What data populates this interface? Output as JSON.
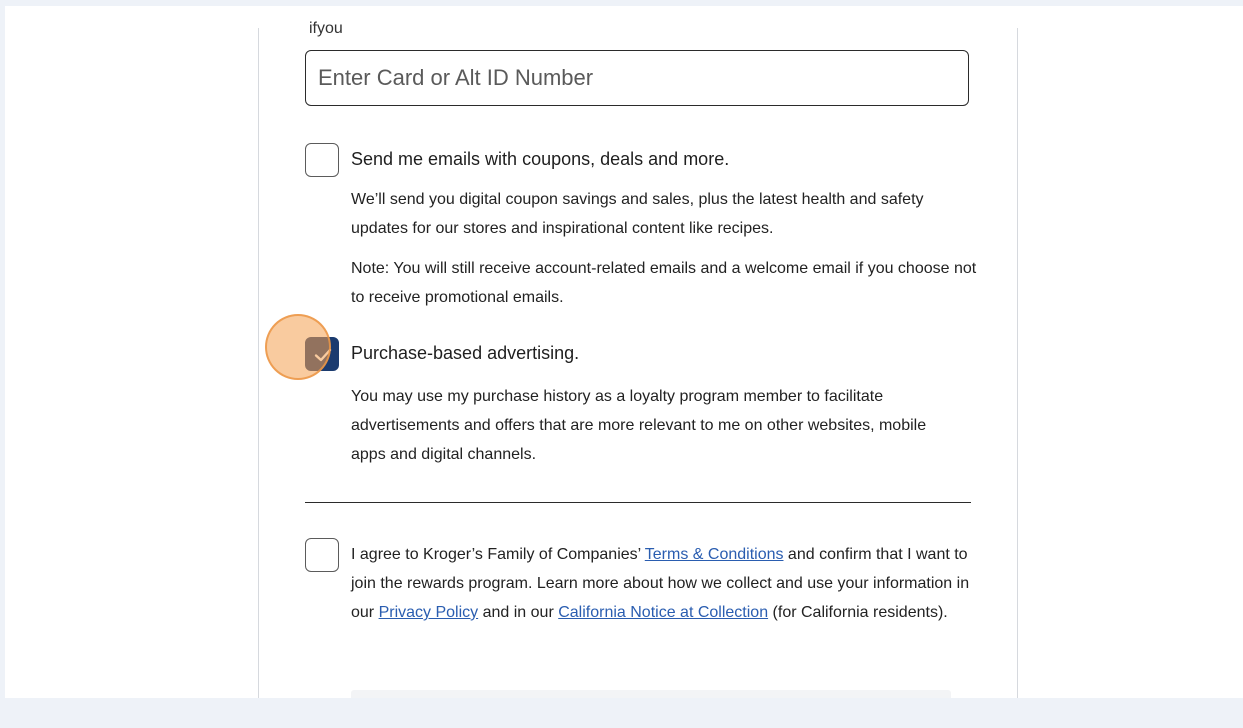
{
  "form": {
    "cutoff_label": "ifyou",
    "card_input": {
      "placeholder": "Enter Card or Alt ID Number",
      "value": ""
    },
    "email_opt_in": {
      "label": "Send me emails with coupons, deals and more.",
      "description": "We’ll send you digital coupon savings and sales, plus the latest health and safety updates for our stores and inspirational content like recipes.",
      "note": "Note: You will still receive account-related emails and a welcome email if you choose not to receive promotional emails.",
      "checked": false
    },
    "purchase_ads": {
      "label": "Purchase-based advertising.",
      "description": "You may use my purchase history as a loyalty program member to facilitate advertisements and offers that are more relevant to me on other websites, mobile apps and digital channels.",
      "checked": true
    },
    "terms": {
      "text_1": "I agree to Kroger’s Family of Companies’ ",
      "terms_link": "Terms & Conditions",
      "text_2": " and confirm that I want to join the rewards program. Learn more about how we collect and use your information in our ",
      "privacy_link": "Privacy Policy",
      "text_3": " and in our ",
      "ca_notice_link": "California Notice at Collection",
      "text_4": " (for California residents).",
      "checked": false
    }
  },
  "colors": {
    "background": "#eef2f8",
    "checkbox_checked": "#1b3b6f",
    "link": "#2a5db0",
    "highlight": "#f4a050"
  }
}
